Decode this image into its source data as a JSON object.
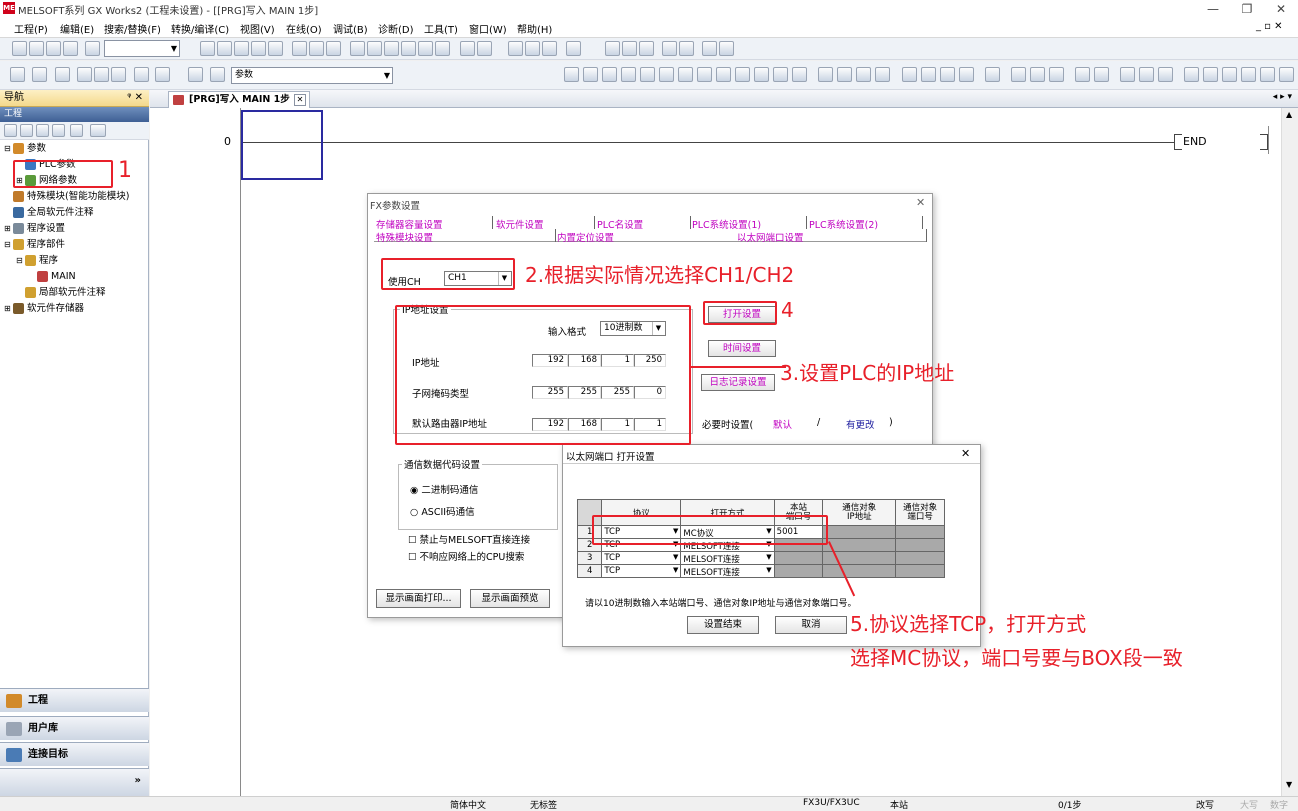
{
  "window": {
    "title": "MELSOFT系列 GX Works2 (工程未设置) - [[PRG]写入 MAIN 1步]",
    "app_icon_text": "ME",
    "minimize": "—",
    "restore": "❐",
    "close": "✕"
  },
  "menu": {
    "items": [
      "工程(P)",
      "编辑(E)",
      "搜索/替换(F)",
      "转换/编译(C)",
      "视图(V)",
      "在线(O)",
      "调试(B)",
      "诊断(D)",
      "工具(T)",
      "窗口(W)",
      "帮助(H)"
    ],
    "mdi_controls": "_ ▫ ✕"
  },
  "toolbar": {
    "search_combo": "参数"
  },
  "nav": {
    "header": "导航",
    "pin": "ᵠ ✕",
    "section": "工程",
    "tree": [
      {
        "label": "参数",
        "indent": 0,
        "expander": "⊟"
      },
      {
        "label": "PLC参数",
        "indent": 1,
        "expander": ""
      },
      {
        "label": "网络参数",
        "indent": 1,
        "expander": "⊞"
      },
      {
        "label": "特殊模块(智能功能模块)",
        "indent": 0,
        "expander": ""
      },
      {
        "label": "全局软元件注释",
        "indent": 0,
        "expander": ""
      },
      {
        "label": "程序设置",
        "indent": 0,
        "expander": "⊞"
      },
      {
        "label": "程序部件",
        "indent": 0,
        "expander": "⊟"
      },
      {
        "label": "程序",
        "indent": 1,
        "expander": "⊟"
      },
      {
        "label": "MAIN",
        "indent": 2,
        "expander": ""
      },
      {
        "label": "局部软元件注释",
        "indent": 1,
        "expander": ""
      },
      {
        "label": "软元件存储器",
        "indent": 0,
        "expander": "⊞"
      }
    ],
    "buttons": [
      "工程",
      "用户库",
      "连接目标"
    ],
    "more": "»"
  },
  "editor": {
    "tab_label": "[PRG]写入 MAIN 1步",
    "tab_close": "✕",
    "tab_nav": "◂ ▸ ▾",
    "rung_number": "0",
    "end_label": "END"
  },
  "fx_dialog": {
    "title": "FX参数设置",
    "close": "✕",
    "tabs_row1": [
      "存储器容量设置",
      "软元件设置",
      "PLC名设置",
      "PLC系统设置(1)",
      "PLC系统设置(2)"
    ],
    "tabs_row2": [
      "特殊模块设置",
      "内置定位设置",
      "以太网端口设置"
    ],
    "ch_label": "使用CH",
    "ch_value": "CH1",
    "ip_group": "IP地址设置",
    "input_format_label": "输入格式",
    "input_format_value": "10进制数",
    "ip_label": "IP地址",
    "ip": [
      "192",
      "168",
      "1",
      "250"
    ],
    "subnet_label": "子网掩码类型",
    "subnet": [
      "255",
      "255",
      "255",
      "0"
    ],
    "gateway_label": "默认路由器IP地址",
    "gateway": [
      "192",
      "168",
      "1",
      "1"
    ],
    "open_settings": "打开设置",
    "time_settings": "时间设置",
    "log_settings": "日志记录设置",
    "required_label": "必要时设置(",
    "required_default": "默认",
    "required_sep": "/",
    "required_changed": "有更改",
    "required_close": ")",
    "comm_group": "通信数据代码设置",
    "binary": "二进制码通信",
    "ascii": "ASCII码通信",
    "chk1": "禁止与MELSOFT直接连接",
    "chk2": "不响应网络上的CPU搜索",
    "print_btn": "显示画面打印...",
    "preview_btn": "显示画面预览"
  },
  "eth_dialog": {
    "title": "以太网端口 打开设置",
    "close": "✕",
    "headers": [
      "协议",
      "打开方式",
      "本站\n端口号",
      "通信对象\nIP地址",
      "通信对象\n端口号"
    ],
    "rows": [
      {
        "no": "1",
        "protocol": "TCP",
        "method": "MC协议",
        "port": "5001"
      },
      {
        "no": "2",
        "protocol": "TCP",
        "method": "MELSOFT连接",
        "port": ""
      },
      {
        "no": "3",
        "protocol": "TCP",
        "method": "MELSOFT连接",
        "port": ""
      },
      {
        "no": "4",
        "protocol": "TCP",
        "method": "MELSOFT连接",
        "port": ""
      }
    ],
    "hint": "请以10进制数输入本站端口号、通信对象IP地址与通信对象端口号。",
    "ok": "设置结束",
    "cancel": "取消"
  },
  "annotations": {
    "a1": "1",
    "a2": "2.根据实际情况选择CH1/CH2",
    "a3": "3.设置PLC的IP地址",
    "a4": "4",
    "a5_line1": "5.协议选择TCP，打开方式",
    "a5_line2": "选择MC协议，端口号要与BOX段一致",
    "color": "#e8202a"
  },
  "status": {
    "lang": "简体中文",
    "title": "无标签",
    "cpu": "FX3U/FX3UC",
    "station": "本站",
    "steps": "0/1步",
    "mode": "改写",
    "caps": "大写",
    "num": "数字"
  }
}
